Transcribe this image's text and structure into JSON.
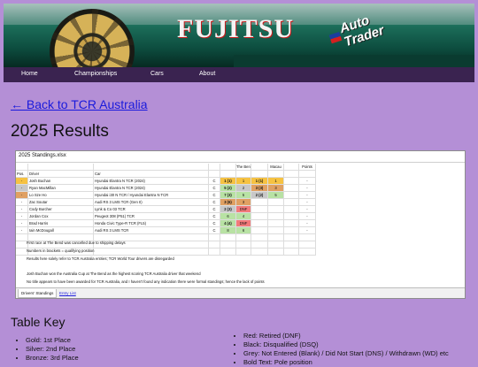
{
  "banner": {
    "sponsor_main": "FUJITSU",
    "sponsor_secondary_line1": "Auto",
    "sponsor_secondary_line2": "Trader"
  },
  "nav": {
    "items": [
      "Home",
      "Championships",
      "Cars",
      "About"
    ]
  },
  "back_link": "← Back to TCR Australia",
  "page_title": "2025 Results",
  "sheet": {
    "filename": "2025 Standings.xlsx",
    "group_headers": {
      "bend": "The Bend",
      "macau": "Macau",
      "points": "Points"
    },
    "col_headers": {
      "pos": "Pos.",
      "driver": "Driver",
      "car": "Car"
    },
    "rows": [
      {
        "pos": "-",
        "driver": "Josh Buchan",
        "car": "Hyundai Elantra N TCR (2024)",
        "cls": "C",
        "r": [
          "1 (1)",
          "1",
          "1 (1)",
          "1"
        ],
        "pts": "-",
        "posc": "gold"
      },
      {
        "pos": "-",
        "driver": "Ryan MacMillan",
        "car": "Hyundai Elantra N TCR (2024)",
        "cls": "C",
        "r": [
          "5 (2)",
          "2",
          "3 (3)",
          "3"
        ],
        "pts": "-",
        "posc": "silver"
      },
      {
        "pos": "-",
        "driver": "Lo Sze Ho",
        "car": "Hyundai i30 N TCR / Hyundai Elantra N TCR",
        "cls": "C",
        "r": [
          "7 (3)",
          "5",
          "2 (2)",
          "5"
        ],
        "pts": "-",
        "posc": "bronze"
      },
      {
        "pos": "-",
        "driver": "Zac Soutar",
        "car": "Audi RS 3 LMS TCR (Gen II)",
        "cls": "C",
        "r": [
          "3 (6)",
          "3",
          "",
          ""
        ],
        "pts": "-",
        "posc": ""
      },
      {
        "pos": "-",
        "driver": "Cody Burcher",
        "car": "Lynk & Co 03 TCR",
        "cls": "C",
        "r": [
          "2 (3)",
          "DNF",
          "",
          ""
        ],
        "pts": "-",
        "posc": ""
      },
      {
        "pos": "-",
        "driver": "Jordan Cox",
        "car": "Peugeot 308 (P51) TCR",
        "cls": "C",
        "r": [
          "6",
          "4",
          "",
          ""
        ],
        "pts": "-",
        "posc": ""
      },
      {
        "pos": "-",
        "driver": "Brad Harris",
        "car": "Honda Civic Type-R TCR (FL5)",
        "cls": "C",
        "r": [
          "4 (4)",
          "DNF",
          "",
          ""
        ],
        "pts": "-",
        "posc": ""
      },
      {
        "pos": "-",
        "driver": "Iain McDougall",
        "car": "Audi RS 3 LMS TCR",
        "cls": "C",
        "r": [
          "8",
          "6",
          "",
          ""
        ],
        "pts": "-",
        "posc": ""
      }
    ],
    "notes": [
      "First race at The Bend was cancelled due to shipping delays",
      "Numbers in brackets = qualifying position",
      "Results here solely refer to TCR Australia entries; TCR World Tour drivers are disregarded",
      "Josh Buchan won the Australia Cup at The Bend as the highest scoring TCR Australia driver that weekend",
      "No title appears to have been awarded for TCR Australia, and I haven't found any indication there were formal standings; hence the lack of points"
    ],
    "tabs": [
      "Drivers' Standings",
      "Entry List"
    ]
  },
  "key": {
    "heading": "Table Key",
    "left": [
      "Gold: 1st Place",
      "Silver: 2nd Place",
      "Bronze: 3rd Place"
    ],
    "right": [
      "Red: Retired (DNF)",
      "Black: Disqualified (DSQ)",
      "Grey: Not Entered (Blank) / Did Not Start (DNS) / Withdrawn (WD) etc",
      "Bold Text: Pole position"
    ]
  },
  "colors": {
    "background": "#b48fd6",
    "nav": "#3a2350",
    "link": "#1a1adc",
    "gold": "#f6c242",
    "silver": "#c8c8c8",
    "bronze": "#e0a062",
    "classified": "#b8e2a4",
    "retired": "#f27a7a"
  }
}
